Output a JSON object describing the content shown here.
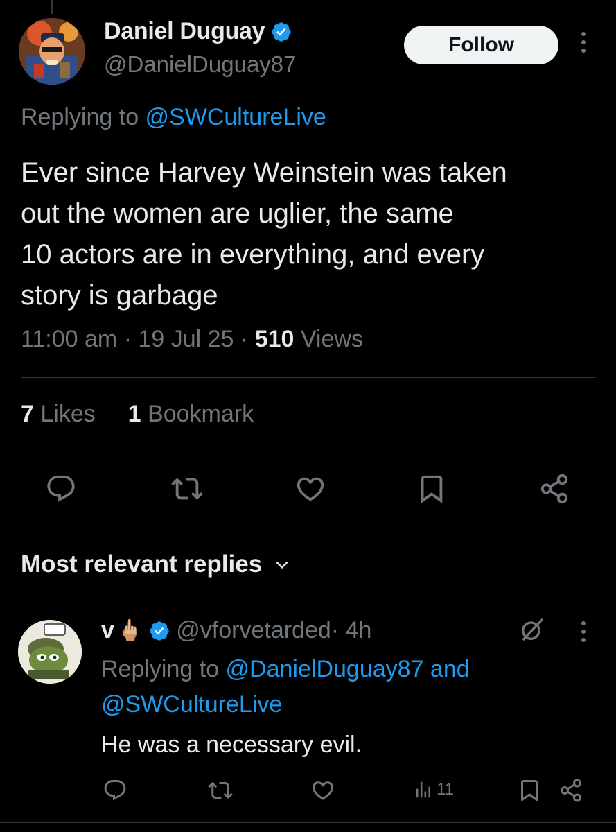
{
  "tweet": {
    "display_name": "Daniel Duguay",
    "handle": "@DanielDuguay87",
    "follow_label": "Follow",
    "replying_prefix": "Replying to ",
    "replying_to": "@SWCultureLive",
    "text_lines": [
      "Ever since Harvey Weinstein was taken",
      "out the women are uglier, the same",
      "10 actors are in everything, and every",
      "story is garbage"
    ],
    "time": "11:00 am",
    "sep": " · ",
    "date": "19 Jul 25",
    "views_count": "510",
    "views_label": " Views",
    "likes_count": "7",
    "likes_label": " Likes",
    "bookmarks_count": "1",
    "bookmarks_label": " Bookmark"
  },
  "replies_section": {
    "title": "Most relevant replies"
  },
  "reply": {
    "name": "v",
    "emoji": "🖕🏼",
    "handle": "@vforvetarded",
    "age": " · 4h",
    "replying_prefix": "Replying to ",
    "replying_to_1": "@DanielDuguay87",
    "replying_and": " and ",
    "replying_to_2": "@SWCultureLive",
    "text": "He was a necessary evil.",
    "views": "11"
  },
  "icons": {
    "verified": "verified-badge-icon",
    "more": "more-vertical-icon",
    "reply": "reply-icon",
    "retweet": "retweet-icon",
    "like": "like-heart-icon",
    "bookmark": "bookmark-icon",
    "share": "share-icon",
    "views": "views-chart-icon",
    "grok": "grok-icon",
    "chevron": "chevron-down-icon"
  },
  "colors": {
    "background": "#000000",
    "text_primary": "#e7e9ea",
    "text_secondary": "#71767b",
    "link": "#1d9bf0",
    "divider": "#2f3336",
    "follow_bg": "#eff3f4"
  }
}
